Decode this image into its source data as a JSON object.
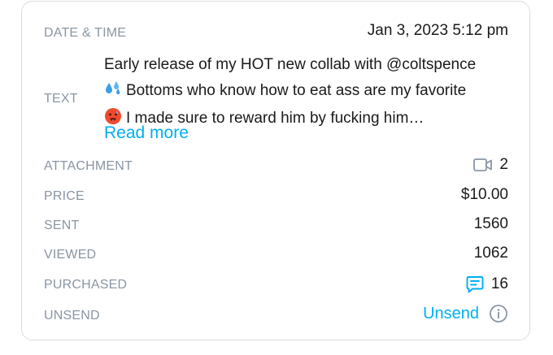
{
  "post": {
    "date_time_label": "DATE & TIME",
    "date_time_value": "Jan 3, 2023 5:12 pm",
    "text_label": "TEXT",
    "text_lines": [
      "Early release of my HOT new collab with @coltspence",
      "Bottoms who know how to eat ass are my favorite",
      "I made sure to reward him by fucking him…"
    ],
    "read_more": "Read more",
    "attachment_label": "ATTACHMENT",
    "attachment_count": "2",
    "attachment_icon": "video-camera-icon",
    "price_label": "PRICE",
    "price_value": "$10.00",
    "sent_label": "SENT",
    "sent_value": "1560",
    "viewed_label": "VIEWED",
    "viewed_value": "1062",
    "purchased_label": "PURCHASED",
    "purchased_value": "16",
    "purchased_icon": "message-list-icon",
    "unsend_label": "UNSEND",
    "unsend_link": "Unsend",
    "unsend_icon": "info-icon"
  },
  "colors": {
    "accent": "#00aff0",
    "label": "#8a96a3",
    "text": "#1a1a1a",
    "border": "#dadde1"
  }
}
